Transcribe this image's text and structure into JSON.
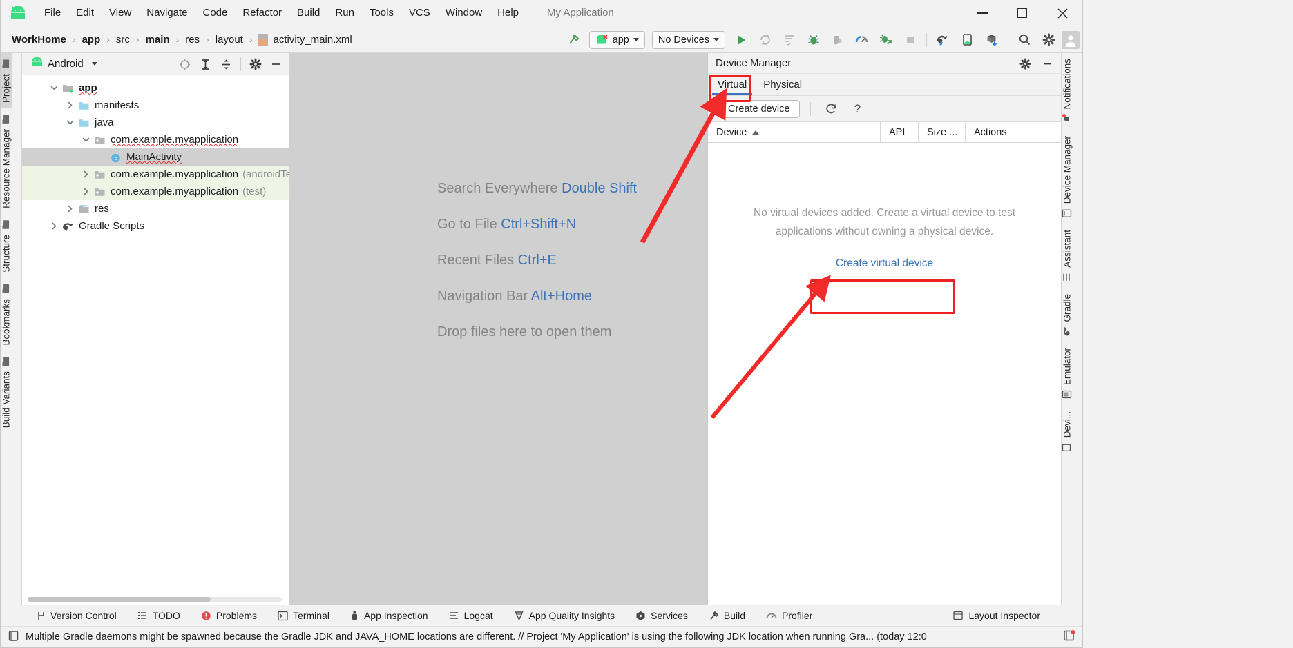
{
  "window": {
    "app_title": "My Application",
    "controls": {
      "minimize": "minimize-icon",
      "maximize": "maximize-icon",
      "close": "close-icon"
    }
  },
  "menubar": {
    "logo": "android-logo-icon",
    "items": [
      "File",
      "Edit",
      "View",
      "Navigate",
      "Code",
      "Refactor",
      "Build",
      "Run",
      "Tools",
      "VCS",
      "Window",
      "Help"
    ]
  },
  "navbar": {
    "breadcrumbs": [
      "WorkHome",
      "app",
      "src",
      "main",
      "res",
      "layout",
      "activity_main.xml"
    ],
    "run_config": "app",
    "device_target": "No Devices",
    "icons": [
      "build-hammer-icon",
      "run-icon",
      "apply-changes-icon",
      "apply-code-changes-icon",
      "debug-icon",
      "attach-debugger-icon",
      "profiler-icon",
      "profile-with-debug-icon",
      "stop-icon",
      "gradle-sync-icon",
      "device-manager-icon",
      "sdk-manager-icon",
      "search-icon",
      "gear-icon",
      "avatar-icon"
    ]
  },
  "left_rail": [
    {
      "label": "Project",
      "icon": "project-folder-icon",
      "selected": true
    },
    {
      "label": "Resource Manager",
      "icon": "resource-icon",
      "selected": false
    },
    {
      "label": "Structure",
      "icon": "structure-icon",
      "selected": false
    },
    {
      "label": "Bookmarks",
      "icon": "bookmark-icon",
      "selected": false
    },
    {
      "label": "Build Variants",
      "icon": "build-variants-icon",
      "selected": false
    }
  ],
  "right_rail": [
    {
      "label": "Notifications",
      "icon": "notifications-icon"
    },
    {
      "label": "Device Manager",
      "icon": "device-manager-icon"
    },
    {
      "label": "Assistant",
      "icon": "assistant-icon"
    },
    {
      "label": "Gradle",
      "icon": "gradle-icon"
    },
    {
      "label": "Emulator",
      "icon": "emulator-icon"
    },
    {
      "label": "Devi...",
      "icon": "device-file-explorer-icon"
    }
  ],
  "project_panel": {
    "title": "Android",
    "actions": [
      "select-opened-file-icon",
      "expand-all-icon",
      "collapse-all-icon",
      "settings-gear-icon",
      "hide-icon"
    ],
    "tree": [
      {
        "label": "app",
        "depth": 0,
        "arrow": "down",
        "icon": "module-folder-icon",
        "bold": true,
        "squiggle": true,
        "state": "normal"
      },
      {
        "label": "manifests",
        "depth": 1,
        "arrow": "right",
        "icon": "folder-icon",
        "bold": false,
        "squiggle": false,
        "state": "normal"
      },
      {
        "label": "java",
        "depth": 1,
        "arrow": "down",
        "icon": "folder-icon",
        "bold": false,
        "squiggle": false,
        "state": "normal"
      },
      {
        "label": "com.example.myapplication",
        "depth": 2,
        "arrow": "down",
        "icon": "package-icon",
        "bold": false,
        "squiggle": true,
        "state": "normal"
      },
      {
        "label": "MainActivity",
        "depth": 3,
        "arrow": "none",
        "icon": "class-icon",
        "bold": false,
        "squiggle": true,
        "state": "selected"
      },
      {
        "label": "com.example.myapplication",
        "suffix": "(androidTes",
        "depth": 2,
        "arrow": "right",
        "icon": "package-icon",
        "bold": false,
        "squiggle": false,
        "state": "test"
      },
      {
        "label": "com.example.myapplication",
        "suffix": "(test)",
        "depth": 2,
        "arrow": "right",
        "icon": "package-icon",
        "bold": false,
        "squiggle": false,
        "state": "test"
      },
      {
        "label": "res",
        "depth": 1,
        "arrow": "right",
        "icon": "res-folder-icon",
        "bold": false,
        "squiggle": false,
        "state": "normal"
      },
      {
        "label": "Gradle Scripts",
        "depth": 0,
        "arrow": "right",
        "icon": "gradle-elephant-icon",
        "bold": false,
        "squiggle": false,
        "state": "normal"
      }
    ]
  },
  "editor": {
    "tips": [
      {
        "action": "Search Everywhere",
        "shortcut": "Double Shift"
      },
      {
        "action": "Go to File",
        "shortcut": "Ctrl+Shift+N"
      },
      {
        "action": "Recent Files",
        "shortcut": "Ctrl+E"
      },
      {
        "action": "Navigation Bar",
        "shortcut": "Alt+Home"
      },
      {
        "action": "Drop files here to open them",
        "shortcut": ""
      }
    ]
  },
  "device_manager": {
    "title": "Device Manager",
    "header_actions": [
      "gear-icon",
      "minimize-icon"
    ],
    "tabs": [
      {
        "label": "Virtual",
        "active": true
      },
      {
        "label": "Physical",
        "active": false
      }
    ],
    "toolbar": {
      "create_device": "Create device",
      "refresh_icon": "refresh-icon",
      "help_icon": "help-icon"
    },
    "columns": [
      "Device",
      "API",
      "Size ...",
      "Actions"
    ],
    "sort_column": "Device",
    "sort_direction": "asc",
    "empty_state": "No virtual devices added. Create a virtual device to test applications without owning a physical device.",
    "empty_action": "Create virtual device"
  },
  "tool_windows": [
    {
      "label": "Version Control",
      "icon": "branch-icon"
    },
    {
      "label": "TODO",
      "icon": "todo-list-icon"
    },
    {
      "label": "Problems",
      "icon": "problems-error-icon"
    },
    {
      "label": "Terminal",
      "icon": "terminal-icon"
    },
    {
      "label": "App Inspection",
      "icon": "app-inspection-icon"
    },
    {
      "label": "Logcat",
      "icon": "logcat-icon"
    },
    {
      "label": "App Quality Insights",
      "icon": "app-quality-insights-icon"
    },
    {
      "label": "Services",
      "icon": "services-icon"
    },
    {
      "label": "Build",
      "icon": "build-hammer-icon"
    },
    {
      "label": "Profiler",
      "icon": "profiler-icon"
    }
  ],
  "tool_windows_right": [
    {
      "label": "Layout Inspector",
      "icon": "layout-inspector-icon"
    }
  ],
  "status_bar": {
    "icon": "event-log-icon",
    "message": "Multiple Gradle daemons might be spawned because the Gradle JDK and JAVA_HOME locations are different. // Project 'My Application' is using the following JDK location when running Gra... (today 12:0",
    "right_icon": "event-log-badge-icon"
  },
  "annotations": {
    "accent": "#ef2020",
    "boxes": [
      {
        "name": "virtual-tab-highlight"
      },
      {
        "name": "create-virtual-device-highlight"
      }
    ],
    "arrows": [
      {
        "name": "arrow-to-virtual-tab"
      },
      {
        "name": "arrow-to-create-virtual-device"
      }
    ]
  }
}
